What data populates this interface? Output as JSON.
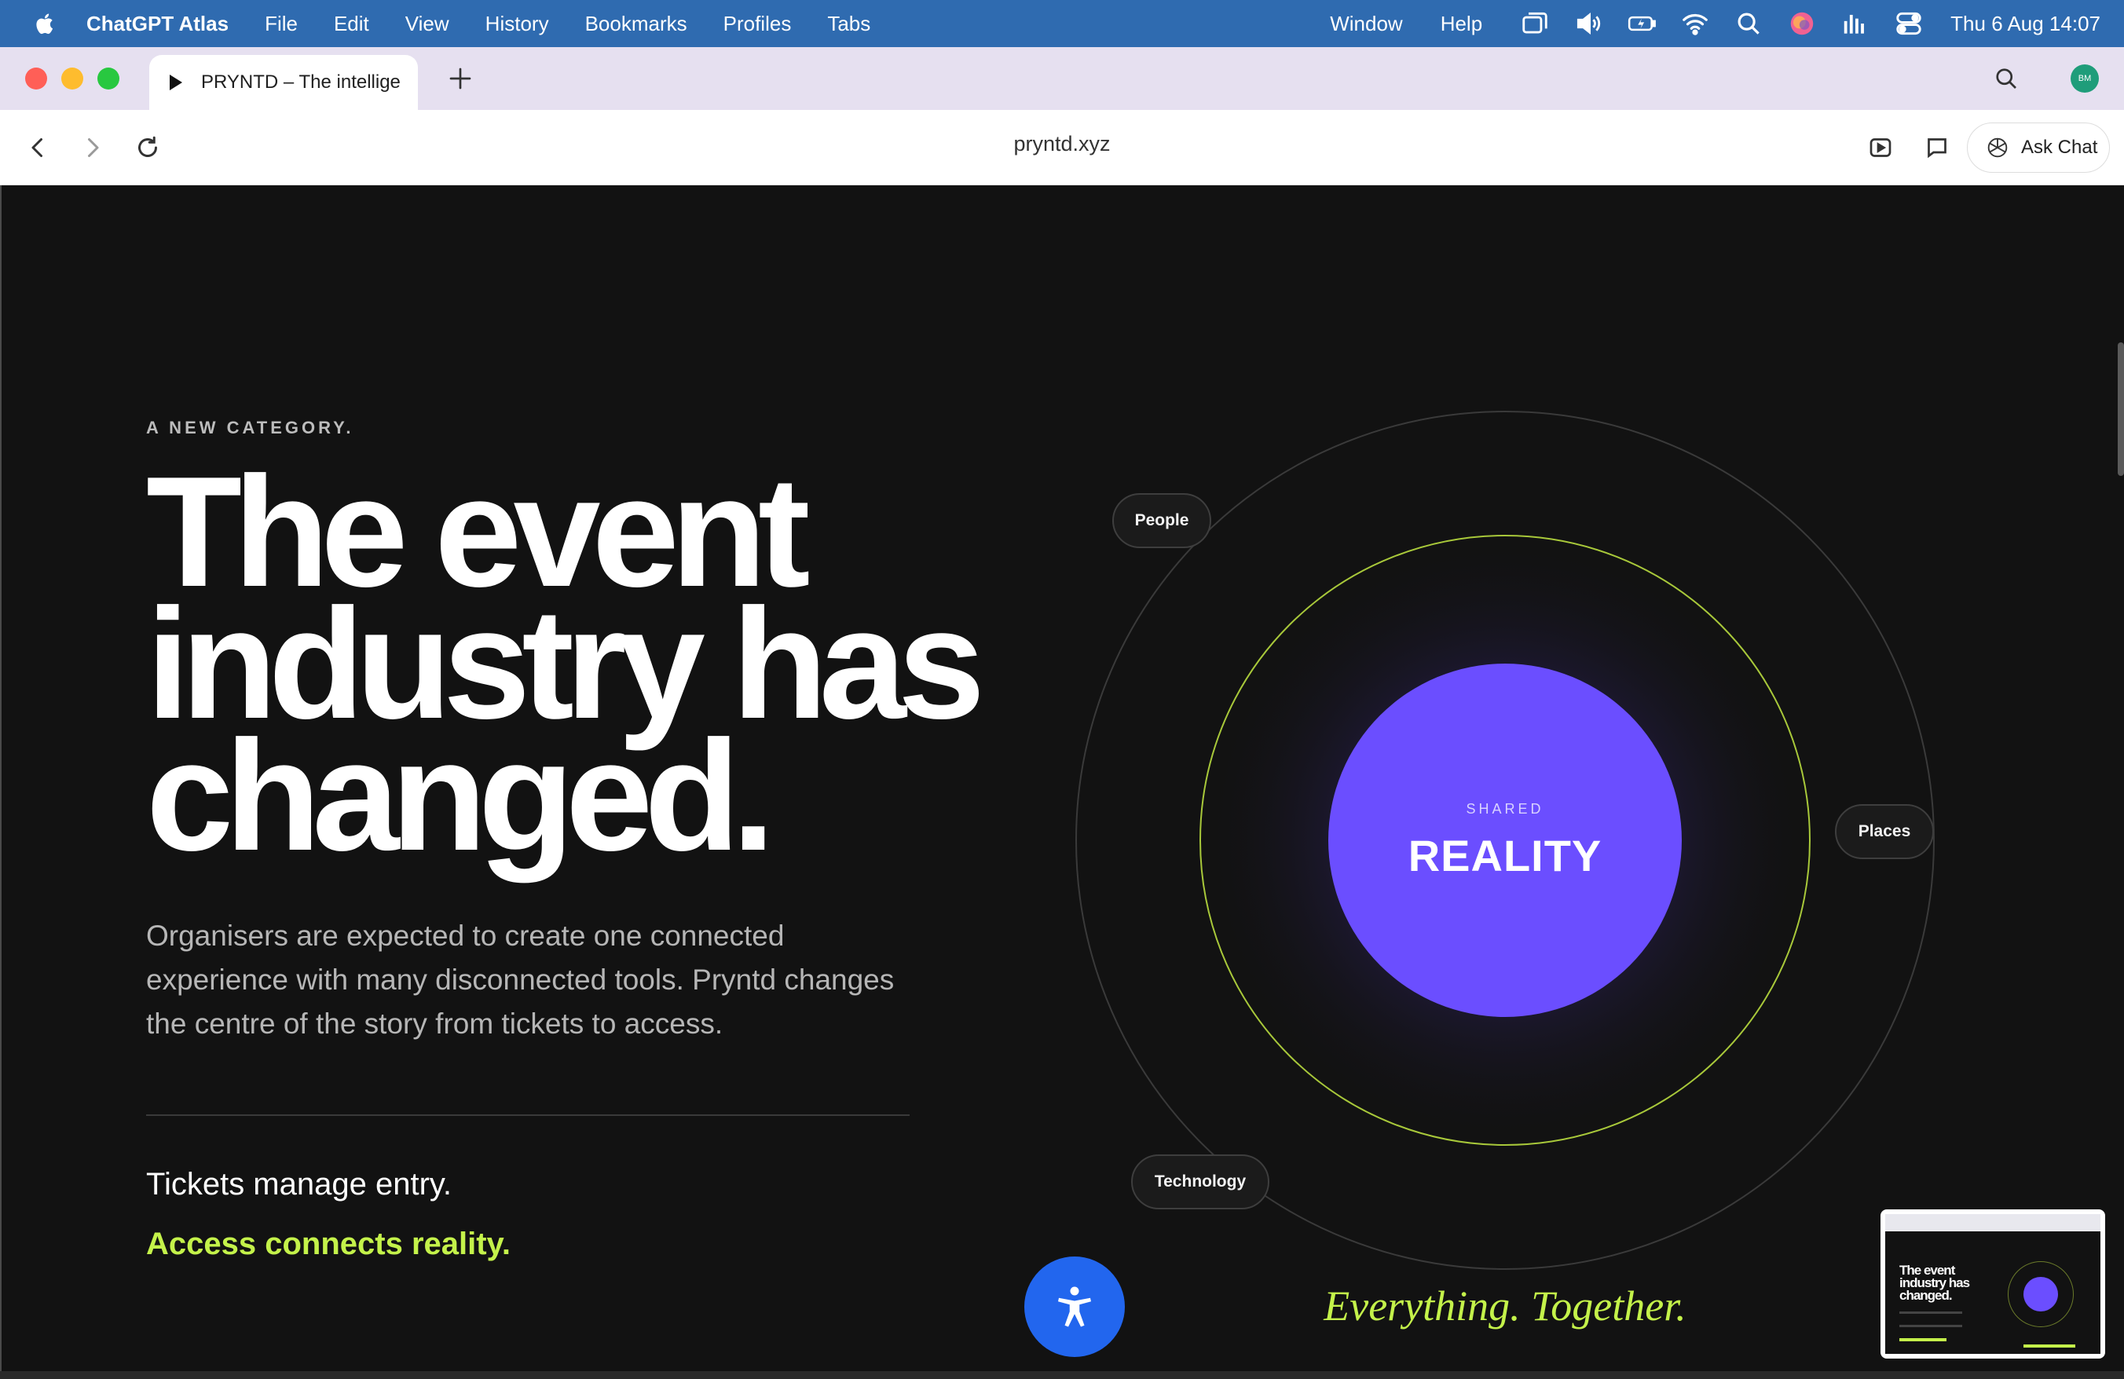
{
  "menubar": {
    "app_name": "ChatGPT Atlas",
    "items": [
      "File",
      "Edit",
      "View",
      "History",
      "Bookmarks",
      "Profiles",
      "Tabs"
    ],
    "right_items": [
      "Window",
      "Help"
    ],
    "clock": "Thu 6 Aug  14:07"
  },
  "browser": {
    "tab_title": "PRYNTD – The intellige",
    "address": "pryntd.xyz",
    "ask_chat_label": "Ask Chat",
    "avatar_initials": "BM"
  },
  "hero": {
    "eyebrow": "A NEW CATEGORY.",
    "headline_lines": [
      "The event",
      "industry has",
      "changed."
    ],
    "lede": "Organisers are expected to create one connected experience with many disconnected tools. Pryntd changes the centre of the story from tickets to access.",
    "line1": "Tickets manage entry.",
    "line2": "Access connects reality."
  },
  "orbit": {
    "core_small": "SHARED",
    "core_big": "REALITY",
    "nodes": {
      "people": "People",
      "places": "Places",
      "technology": "Technology"
    },
    "tagline": "Everything. Together."
  },
  "colors": {
    "accent_lime": "#c4f24a",
    "core_purple": "#6b4eff",
    "page_bg": "#121212",
    "a11y_blue": "#2266ee",
    "menubar_blue": "#2f6bb0"
  },
  "icons": {
    "a11y": "accessibility-icon",
    "menubar_status": [
      "window-icon",
      "volume-icon",
      "battery-icon",
      "wifi-icon",
      "spotlight-icon",
      "siri-icon",
      "stats-icon",
      "control-center-icon"
    ]
  }
}
